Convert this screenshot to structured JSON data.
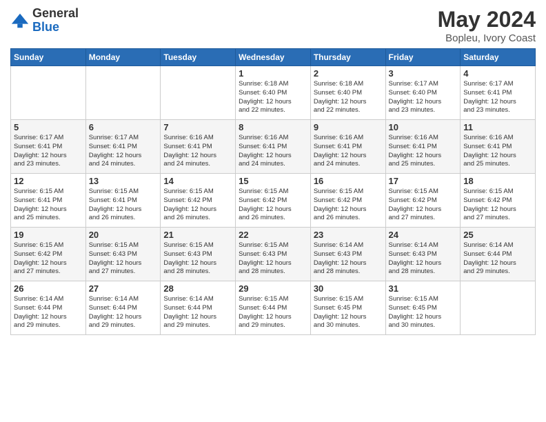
{
  "logo": {
    "general": "General",
    "blue": "Blue"
  },
  "header": {
    "title": "May 2024",
    "subtitle": "Bopleu, Ivory Coast"
  },
  "days_of_week": [
    "Sunday",
    "Monday",
    "Tuesday",
    "Wednesday",
    "Thursday",
    "Friday",
    "Saturday"
  ],
  "weeks": [
    [
      {
        "day": "",
        "info": ""
      },
      {
        "day": "",
        "info": ""
      },
      {
        "day": "",
        "info": ""
      },
      {
        "day": "1",
        "info": "Sunrise: 6:18 AM\nSunset: 6:40 PM\nDaylight: 12 hours\nand 22 minutes."
      },
      {
        "day": "2",
        "info": "Sunrise: 6:18 AM\nSunset: 6:40 PM\nDaylight: 12 hours\nand 22 minutes."
      },
      {
        "day": "3",
        "info": "Sunrise: 6:17 AM\nSunset: 6:40 PM\nDaylight: 12 hours\nand 23 minutes."
      },
      {
        "day": "4",
        "info": "Sunrise: 6:17 AM\nSunset: 6:41 PM\nDaylight: 12 hours\nand 23 minutes."
      }
    ],
    [
      {
        "day": "5",
        "info": "Sunrise: 6:17 AM\nSunset: 6:41 PM\nDaylight: 12 hours\nand 23 minutes."
      },
      {
        "day": "6",
        "info": "Sunrise: 6:17 AM\nSunset: 6:41 PM\nDaylight: 12 hours\nand 24 minutes."
      },
      {
        "day": "7",
        "info": "Sunrise: 6:16 AM\nSunset: 6:41 PM\nDaylight: 12 hours\nand 24 minutes."
      },
      {
        "day": "8",
        "info": "Sunrise: 6:16 AM\nSunset: 6:41 PM\nDaylight: 12 hours\nand 24 minutes."
      },
      {
        "day": "9",
        "info": "Sunrise: 6:16 AM\nSunset: 6:41 PM\nDaylight: 12 hours\nand 24 minutes."
      },
      {
        "day": "10",
        "info": "Sunrise: 6:16 AM\nSunset: 6:41 PM\nDaylight: 12 hours\nand 25 minutes."
      },
      {
        "day": "11",
        "info": "Sunrise: 6:16 AM\nSunset: 6:41 PM\nDaylight: 12 hours\nand 25 minutes."
      }
    ],
    [
      {
        "day": "12",
        "info": "Sunrise: 6:15 AM\nSunset: 6:41 PM\nDaylight: 12 hours\nand 25 minutes."
      },
      {
        "day": "13",
        "info": "Sunrise: 6:15 AM\nSunset: 6:41 PM\nDaylight: 12 hours\nand 26 minutes."
      },
      {
        "day": "14",
        "info": "Sunrise: 6:15 AM\nSunset: 6:42 PM\nDaylight: 12 hours\nand 26 minutes."
      },
      {
        "day": "15",
        "info": "Sunrise: 6:15 AM\nSunset: 6:42 PM\nDaylight: 12 hours\nand 26 minutes."
      },
      {
        "day": "16",
        "info": "Sunrise: 6:15 AM\nSunset: 6:42 PM\nDaylight: 12 hours\nand 26 minutes."
      },
      {
        "day": "17",
        "info": "Sunrise: 6:15 AM\nSunset: 6:42 PM\nDaylight: 12 hours\nand 27 minutes."
      },
      {
        "day": "18",
        "info": "Sunrise: 6:15 AM\nSunset: 6:42 PM\nDaylight: 12 hours\nand 27 minutes."
      }
    ],
    [
      {
        "day": "19",
        "info": "Sunrise: 6:15 AM\nSunset: 6:42 PM\nDaylight: 12 hours\nand 27 minutes."
      },
      {
        "day": "20",
        "info": "Sunrise: 6:15 AM\nSunset: 6:43 PM\nDaylight: 12 hours\nand 27 minutes."
      },
      {
        "day": "21",
        "info": "Sunrise: 6:15 AM\nSunset: 6:43 PM\nDaylight: 12 hours\nand 28 minutes."
      },
      {
        "day": "22",
        "info": "Sunrise: 6:15 AM\nSunset: 6:43 PM\nDaylight: 12 hours\nand 28 minutes."
      },
      {
        "day": "23",
        "info": "Sunrise: 6:14 AM\nSunset: 6:43 PM\nDaylight: 12 hours\nand 28 minutes."
      },
      {
        "day": "24",
        "info": "Sunrise: 6:14 AM\nSunset: 6:43 PM\nDaylight: 12 hours\nand 28 minutes."
      },
      {
        "day": "25",
        "info": "Sunrise: 6:14 AM\nSunset: 6:44 PM\nDaylight: 12 hours\nand 29 minutes."
      }
    ],
    [
      {
        "day": "26",
        "info": "Sunrise: 6:14 AM\nSunset: 6:44 PM\nDaylight: 12 hours\nand 29 minutes."
      },
      {
        "day": "27",
        "info": "Sunrise: 6:14 AM\nSunset: 6:44 PM\nDaylight: 12 hours\nand 29 minutes."
      },
      {
        "day": "28",
        "info": "Sunrise: 6:14 AM\nSunset: 6:44 PM\nDaylight: 12 hours\nand 29 minutes."
      },
      {
        "day": "29",
        "info": "Sunrise: 6:15 AM\nSunset: 6:44 PM\nDaylight: 12 hours\nand 29 minutes."
      },
      {
        "day": "30",
        "info": "Sunrise: 6:15 AM\nSunset: 6:45 PM\nDaylight: 12 hours\nand 30 minutes."
      },
      {
        "day": "31",
        "info": "Sunrise: 6:15 AM\nSunset: 6:45 PM\nDaylight: 12 hours\nand 30 minutes."
      },
      {
        "day": "",
        "info": ""
      }
    ]
  ]
}
